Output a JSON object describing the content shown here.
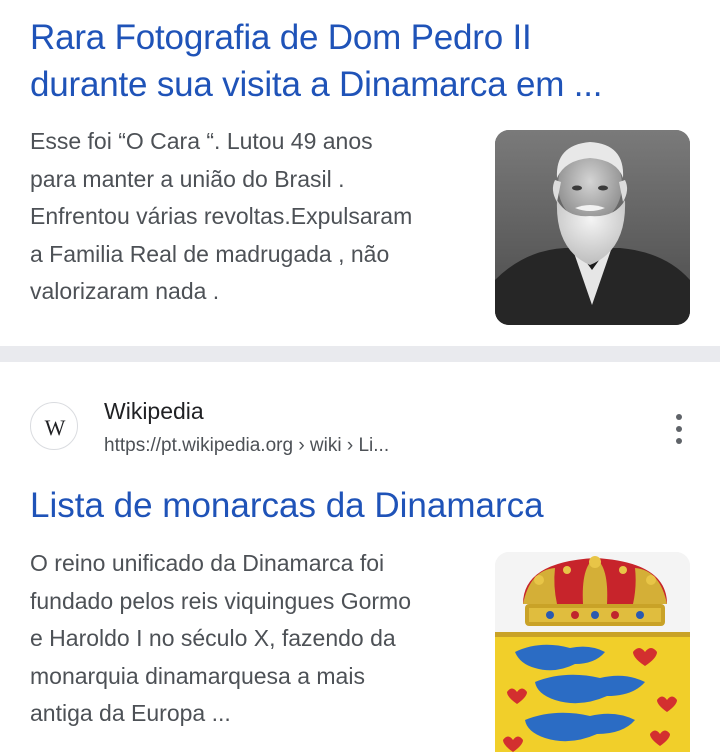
{
  "results": [
    {
      "title_lines": [
        "Rara Fotografia de Dom Pedro II",
        "durante sua visita a Dinamarca em ..."
      ],
      "snippet_lines": [
        "Esse foi “O Cara “. Lutou 49 anos",
        "para manter a união do Brasil .",
        "Enfrentou várias revoltas.Expulsaram",
        "a Familia Real de madrugada , não",
        "valorizaram nada ."
      ],
      "thumbnail_icon": "portrait-photo"
    },
    {
      "favicon_letter": "W",
      "favicon_icon": "wikipedia-icon",
      "site_name": "Wikipedia",
      "url": "https://pt.wikipedia.org › wiki › Li...",
      "menu_icon": "more-vert-icon",
      "title": "Lista de monarcas da Dinamarca",
      "snippet_lines": [
        "O reino unificado da Dinamarca foi",
        "fundado pelos reis viquingues Gormo",
        "e Haroldo I no século X, fazendo da",
        "monarquia dinamarquesa a mais",
        "antiga da Europa ..."
      ],
      "thumbnail_icon": "coat-of-arms"
    }
  ],
  "colors": {
    "link": "#1f53b8",
    "snippet": "#4d5156",
    "separator": "#e9eaee"
  }
}
